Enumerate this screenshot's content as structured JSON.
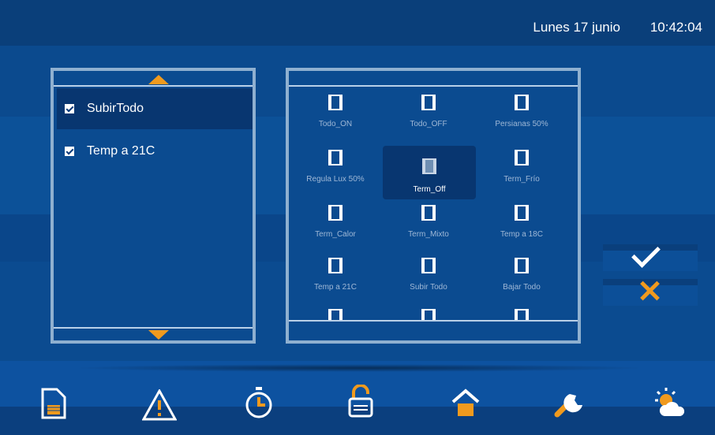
{
  "header": {
    "date": "Lunes 17 junio",
    "time": "10:42:04"
  },
  "list": {
    "items": [
      {
        "label": "SubirTodo",
        "checked": true,
        "selected": true
      },
      {
        "label": "Temp a 21C",
        "checked": true,
        "selected": false
      }
    ]
  },
  "scenes": [
    {
      "label": "Todo_ON"
    },
    {
      "label": "Todo_OFF"
    },
    {
      "label": "Persianas 50%"
    },
    {
      "label": "Regula Lux 50%"
    },
    {
      "label": "Term_Off",
      "selected": true
    },
    {
      "label": "Term_Frío"
    },
    {
      "label": "Term_Calor"
    },
    {
      "label": "Term_Mixto"
    },
    {
      "label": "Temp a 18C"
    },
    {
      "label": "Temp a 21C"
    },
    {
      "label": "Subir Todo"
    },
    {
      "label": "Bajar Todo"
    }
  ],
  "actions": {
    "confirm_icon": "check-icon",
    "cancel_icon": "x-icon"
  },
  "nav": [
    {
      "icon": "document-icon"
    },
    {
      "icon": "alert-icon"
    },
    {
      "icon": "timer-icon"
    },
    {
      "icon": "unlock-icon"
    },
    {
      "icon": "home-icon"
    },
    {
      "icon": "wrench-icon"
    },
    {
      "icon": "weather-icon"
    }
  ],
  "colors": {
    "accent": "#f09a1e",
    "background": "#0b4b90",
    "selected": "#083670"
  }
}
